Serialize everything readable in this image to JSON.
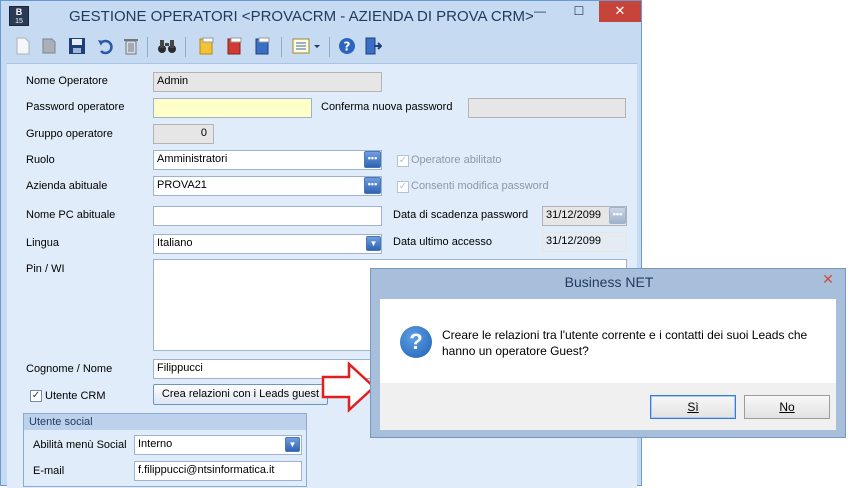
{
  "main_window": {
    "title": "GESTIONE OPERATORI <PROVACRM - AZIENDA DI PROVA CRM>",
    "logo_text": "B",
    "logo_sub": "15",
    "minimize_label": "—",
    "maximize_label": "☐",
    "close_label": "✕"
  },
  "toolbar": {
    "icons": [
      "new-document-icon",
      "save-gray-icon",
      "save-icon",
      "undo-icon",
      "delete-icon",
      "binoculars-icon",
      "folder-yellow-icon",
      "folder-red-icon",
      "folder-blue-icon",
      "list-dropdown-icon",
      "help-icon",
      "exit-icon"
    ]
  },
  "form": {
    "nome_operatore": {
      "label": "Nome Operatore",
      "value": "Admin"
    },
    "password_operatore": {
      "label": "Password operatore",
      "value": ""
    },
    "conferma_password": {
      "label": "Conferma nuova password",
      "value": ""
    },
    "gruppo_operatore": {
      "label": "Gruppo operatore",
      "value": "0"
    },
    "ruolo": {
      "label": "Ruolo",
      "value": "Amministratori"
    },
    "operatore_abilitato": {
      "label": "Operatore abilitato",
      "checked": true
    },
    "azienda_abituale": {
      "label": "Azienda abituale",
      "value": "PROVA21"
    },
    "consenti_modifica": {
      "label": "Consenti modifica password",
      "checked": true
    },
    "nome_pc": {
      "label": "Nome PC abituale",
      "value": ""
    },
    "data_scadenza": {
      "label": "Data di scadenza password",
      "value": "31/12/2099"
    },
    "lingua": {
      "label": "Lingua",
      "value": "Italiano"
    },
    "data_ultimo_accesso": {
      "label": "Data ultimo accesso",
      "value": "31/12/2099"
    },
    "pin_wi": {
      "label": "Pin / WI",
      "value": ""
    },
    "cognome_nome": {
      "label": "Cognome /  Nome",
      "value": "Filippucci"
    },
    "utente_crm": {
      "label": "Utente CRM",
      "checked": true
    },
    "crea_relazioni_button": "Crea relazioni con i Leads guest",
    "social": {
      "header": "Utente social",
      "abilita_menu": {
        "label": "Abilità menù Social",
        "value": "Interno"
      },
      "email": {
        "label": "E-mail",
        "value": "f.filippucci@ntsinformatica.it"
      }
    }
  },
  "dialog": {
    "title": "Business NET",
    "close_label": "✕",
    "message": "Creare le relazioni tra l'utente corrente e i contatti dei suoi Leads che hanno un operatore Guest?",
    "yes_button": "Sì",
    "no_button": "No"
  },
  "colors": {
    "window_bg": "#c6dbf1",
    "panel_bg": "#e0ecf9",
    "close_red": "#c7443a",
    "arrow_red": "#e02020",
    "dialog_frame": "#a8bfdb"
  }
}
